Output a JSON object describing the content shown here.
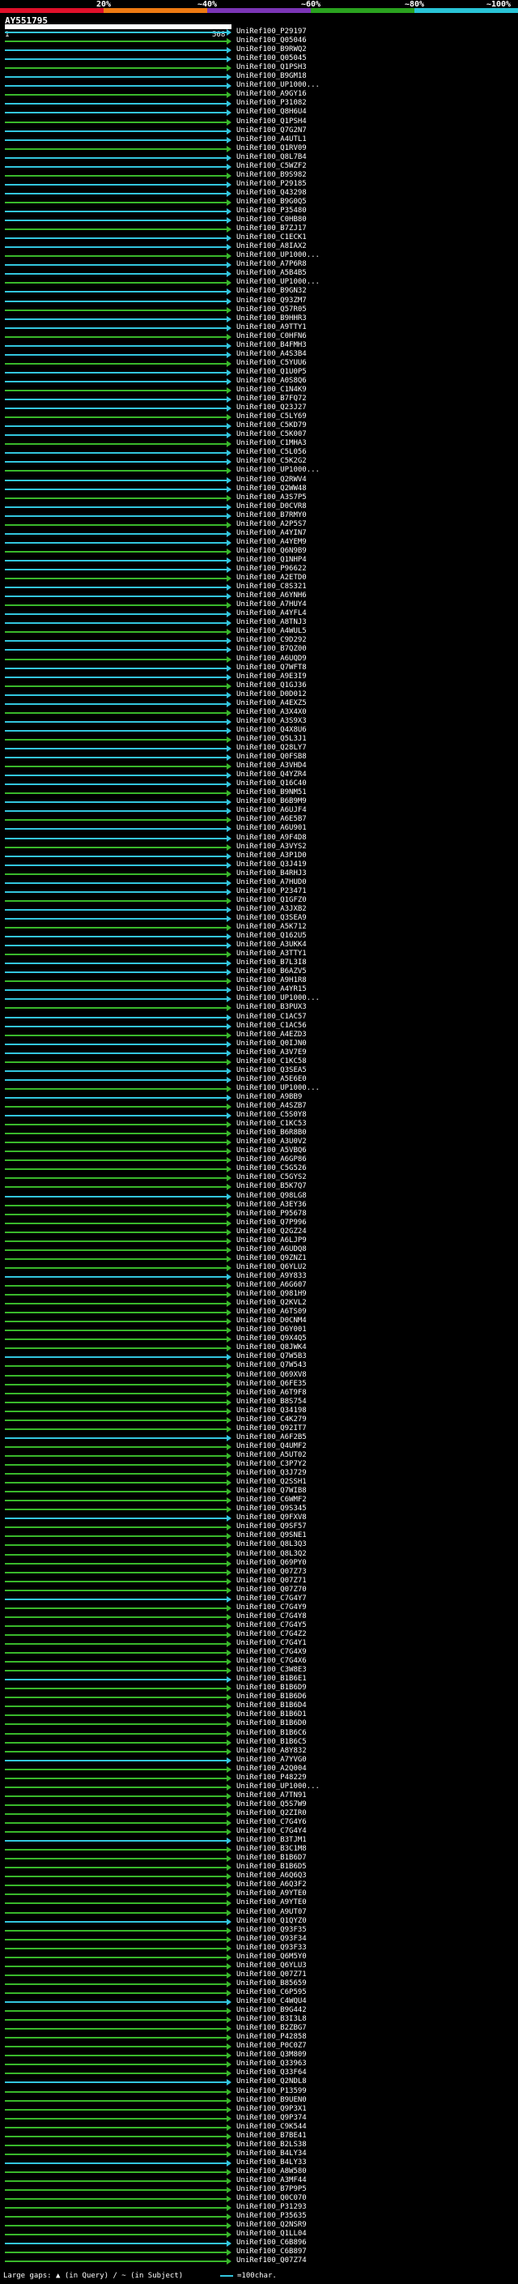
{
  "scale": {
    "labels": [
      "20%",
      "~40%",
      "~60%",
      "~80%",
      "~100%"
    ],
    "colors": [
      "#e0102a",
      "#ee7a12",
      "#7b35b6",
      "#2aa21f",
      "#29c4d6"
    ]
  },
  "query": {
    "name": "AY551795",
    "start": "1",
    "end": "508"
  },
  "colors": {
    "high": "#33c6de",
    "mid": "#39b82b"
  },
  "hits": [
    "UniRef100_P29197",
    "UniRef100_Q05046",
    "UniRef100_B9RWQ2",
    "UniRef100_Q05045",
    "UniRef100_Q1PSH3",
    "UniRef100_B9GM18",
    "UniRef100_UP1000...",
    "UniRef100_A9GY16",
    "UniRef100_P31082",
    "UniRef100_Q8H6U4",
    "UniRef100_Q1PSH4",
    "UniRef100_Q7G2N7",
    "UniRef100_A4UTL1",
    "UniRef100_Q1RV09",
    "UniRef100_Q8L7B4",
    "UniRef100_C5WZF2",
    "UniRef100_B9S982",
    "UniRef100_P29185",
    "UniRef100_Q43298",
    "UniRef100_B9G0Q5",
    "UniRef100_P35480",
    "UniRef100_C0HB80",
    "UniRef100_B7ZJ17",
    "UniRef100_C1ECK1",
    "UniRef100_A8IAX2",
    "UniRef100_UP1000...",
    "UniRef100_A7P6R8",
    "UniRef100_A5B4B5",
    "UniRef100_UP1000...",
    "UniRef100_B9GN32",
    "UniRef100_Q93ZM7",
    "UniRef100_Q57R05",
    "UniRef100_B9HHR3",
    "UniRef100_A9TTY1",
    "UniRef100_C0HFN6",
    "UniRef100_B4FMH3",
    "UniRef100_A4S3B4",
    "UniRef100_C5YUU6",
    "UniRef100_Q1U0P5",
    "UniRef100_A0S8Q6",
    "UniRef100_C1N4K9",
    "UniRef100_B7FQ72",
    "UniRef100_Q23J27",
    "UniRef100_C5LY69",
    "UniRef100_C5KD79",
    "UniRef100_C5K007",
    "UniRef100_C1MHA3",
    "UniRef100_C5L056",
    "UniRef100_C5K2G2",
    "UniRef100_UP1000...",
    "UniRef100_Q2RWV4",
    "UniRef100_Q2WW48",
    "UniRef100_A3S7P5",
    "UniRef100_D0CVR8",
    "UniRef100_B7RMY0",
    "UniRef100_A2P5S7",
    "UniRef100_A4YIN7",
    "UniRef100_A4YEM9",
    "UniRef100_Q6N9B9",
    "UniRef100_Q1NHP4",
    "UniRef100_P96622",
    "UniRef100_A2ETD0",
    "UniRef100_C8S321",
    "UniRef100_A6YNH6",
    "UniRef100_A7HUY4",
    "UniRef100_A4YFL4",
    "UniRef100_A8TNJ3",
    "UniRef100_A4WUL5",
    "UniRef100_C9D292",
    "UniRef100_B7QZ00",
    "UniRef100_A6UQD9",
    "UniRef100_Q7WFT8",
    "UniRef100_A9E3I9",
    "UniRef100_Q1GJ36",
    "UniRef100_D0D012",
    "UniRef100_A4EXZ5",
    "UniRef100_A3X4X0",
    "UniRef100_A3S9X3",
    "UniRef100_Q4X8U6",
    "UniRef100_Q5L3J1",
    "UniRef100_Q28LY7",
    "UniRef100_Q0FSB8",
    "UniRef100_A3VHD4",
    "UniRef100_Q4YZR4",
    "UniRef100_Q16C40",
    "UniRef100_B9NM51",
    "UniRef100_B6B9M9",
    "UniRef100_A6UJF4",
    "UniRef100_A6E5B7",
    "UniRef100_A6U901",
    "UniRef100_A9F4D8",
    "UniRef100_A3VYS2",
    "UniRef100_A3P1D0",
    "UniRef100_Q3J419",
    "UniRef100_B4RHJ3",
    "UniRef100_A7HUD0",
    "UniRef100_P23471",
    "UniRef100_Q1GFZ0",
    "UniRef100_A3JXB2",
    "UniRef100_Q3SEA9",
    "UniRef100_A5K712",
    "UniRef100_Q162U5",
    "UniRef100_A3UKK4",
    "UniRef100_A3TTY1",
    "UniRef100_B7L3I8",
    "UniRef100_B6AZV5",
    "UniRef100_A9H1R8",
    "UniRef100_A4YR15",
    "UniRef100_UP1000...",
    "UniRef100_B3PUX3",
    "UniRef100_C1AC57",
    "UniRef100_C1AC56",
    "UniRef100_A4EZD3",
    "UniRef100_Q0IJN0",
    "UniRef100_A3V7E9",
    "UniRef100_C1KC58",
    "UniRef100_Q3SEA5",
    "UniRef100_A5E6E0",
    "UniRef100_UP1000...",
    "UniRef100_A9BB9",
    "UniRef100_A4SZB7",
    "UniRef100_C5S0Y8",
    "UniRef100_C1KC53",
    "UniRef100_B6R8B0",
    "UniRef100_A3U0V2",
    "UniRef100_A5VBQ6",
    "UniRef100_A6GP86",
    "UniRef100_C5G526",
    "UniRef100_C5GYS2",
    "UniRef100_B5K7Q7",
    "UniRef100_Q98LG8",
    "UniRef100_A3EY36",
    "UniRef100_P95678",
    "UniRef100_Q7P996",
    "UniRef100_Q2GZ24",
    "UniRef100_A6LJP9",
    "UniRef100_A6UDQ8",
    "UniRef100_Q9ZNZ1",
    "UniRef100_Q6YLU2",
    "UniRef100_A9Y833",
    "UniRef100_A6G607",
    "UniRef100_Q981H9",
    "UniRef100_Q2KVL2",
    "UniRef100_A6TS09",
    "UniRef100_D0CNM4",
    "UniRef100_D6Y001",
    "UniRef100_Q9X4Q5",
    "UniRef100_Q8JWK4",
    "UniRef100_Q7W5B3",
    "UniRef100_Q7W543",
    "UniRef100_Q69XV8",
    "UniRef100_Q6FE35",
    "UniRef100_A6T9F8",
    "UniRef100_B8S754",
    "UniRef100_Q34198",
    "UniRef100_C4K279",
    "UniRef100_Q92IT7",
    "UniRef100_A6F2B5",
    "UniRef100_Q4UMF2",
    "UniRef100_A5UT02",
    "UniRef100_C3P7Y2",
    "UniRef100_Q3J729",
    "UniRef100_Q2SSH1",
    "UniRef100_Q7WIB8",
    "UniRef100_C6WMF2",
    "UniRef100_Q9S345",
    "UniRef100_Q9FXV8",
    "UniRef100_Q9SF57",
    "UniRef100_Q9SNE1",
    "UniRef100_Q8L3Q3",
    "UniRef100_Q8L3Q2",
    "UniRef100_Q69PY0",
    "UniRef100_Q07Z73",
    "UniRef100_Q07Z71",
    "UniRef100_Q07Z70",
    "UniRef100_C7G4Y7",
    "UniRef100_C7G4Y9",
    "UniRef100_C7G4Y8",
    "UniRef100_C7G4Y5",
    "UniRef100_C7G4Z2",
    "UniRef100_C7G4Y1",
    "UniRef100_C7G4X9",
    "UniRef100_C7G4X6",
    "UniRef100_C3W8E3",
    "UniRef100_B1B6E1",
    "UniRef100_B1B6D9",
    "UniRef100_B1B6D6",
    "UniRef100_B1B6D4",
    "UniRef100_B1B6D1",
    "UniRef100_B1B6D0",
    "UniRef100_B1B6C6",
    "UniRef100_B1B6C5",
    "UniRef100_A8Y832",
    "UniRef100_A7YVG0",
    "UniRef100_A2Q004",
    "UniRef100_P48229",
    "UniRef100_UP1000...",
    "UniRef100_A7TN91",
    "UniRef100_Q5S7W9",
    "UniRef100_Q2ZIR0",
    "UniRef100_C7G4Y6",
    "UniRef100_C7G4Y4",
    "UniRef100_B3TJM1",
    "UniRef100_B3C1M8",
    "UniRef100_B1B6D7",
    "UniRef100_B1B6D5",
    "UniRef100_A6Q6Q3",
    "UniRef100_A6Q3F2",
    "UniRef100_A9YTE0",
    "UniRef100_A9YTE0",
    "UniRef100_A9UT07",
    "UniRef100_Q1QYZ0",
    "UniRef100_Q93F35",
    "UniRef100_Q93F34",
    "UniRef100_Q93F33",
    "UniRef100_Q6M5Y0",
    "UniRef100_Q6YLU3",
    "UniRef100_Q07Z71",
    "UniRef100_B85659",
    "UniRef100_C6P595",
    "UniRef100_C4WQU4",
    "UniRef100_B9G442",
    "UniRef100_B3I3L8",
    "UniRef100_B2ZBG7",
    "UniRef100_P42858",
    "UniRef100_P0C0Z7",
    "UniRef100_Q3M809",
    "UniRef100_Q33963",
    "UniRef100_Q33F64",
    "UniRef100_Q2NDL8",
    "UniRef100_P13599",
    "UniRef100_B9UEN0",
    "UniRef100_Q9P3X1",
    "UniRef100_Q9P374",
    "UniRef100_C9K544",
    "UniRef100_B7BE41",
    "UniRef100_B2LS38",
    "UniRef100_B4LY34",
    "UniRef100_B4LY33",
    "UniRef100_A8W580",
    "UniRef100_A3MF44",
    "UniRef100_B7P9P5",
    "UniRef100_Q0C070",
    "UniRef100_P31293",
    "UniRef100_P35635",
    "UniRef100_Q2NSR9",
    "UniRef100_Q1LL04",
    "UniRef100_C6B896",
    "UniRef100_C6B897",
    "UniRef100_Q07Z74"
  ],
  "footer": {
    "gaps": "Large gaps: ▲ (in Query) / ~ (in Subject)",
    "legend": "=100char."
  }
}
